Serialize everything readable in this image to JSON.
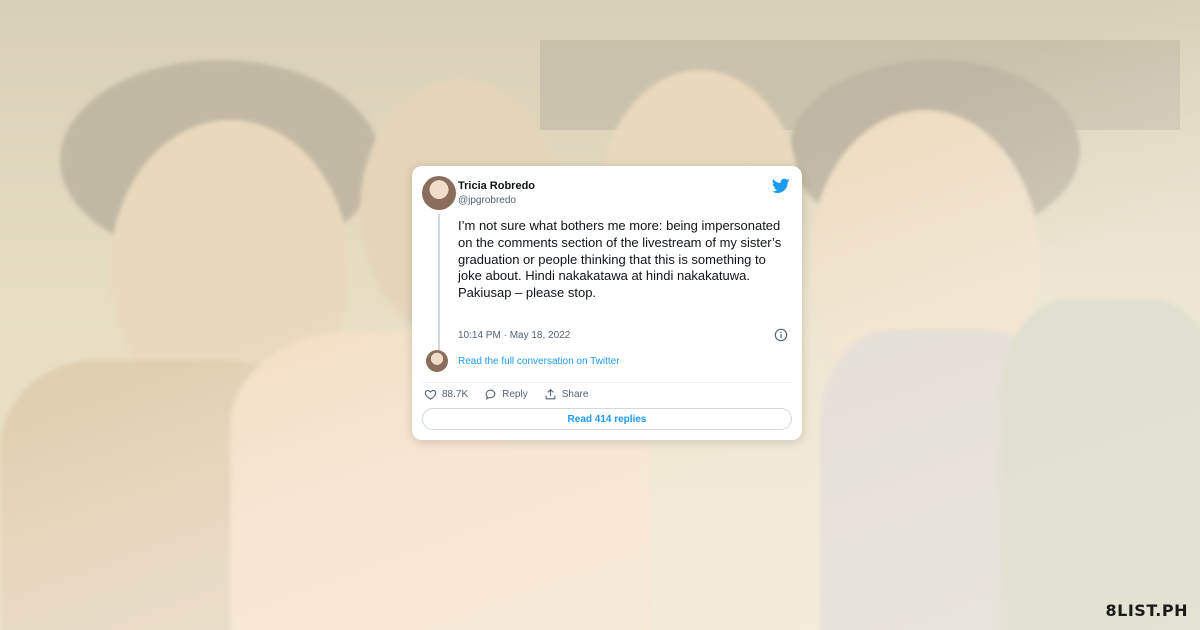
{
  "tweet": {
    "author_name": "Tricia Robredo",
    "author_handle": "@jpgrobredo",
    "text": "I’m not sure what bothers me more: being impersonated on the comments section of the livestream of my sister’s graduation or people thinking that this is something to joke about. Hindi nakakatawa at hindi nakakatuwa. Pakiusap – please stop.",
    "timestamp": "10:14 PM · May 18, 2022",
    "full_conversation_link": "Read the full conversation on Twitter",
    "likes_count": "88.7K",
    "reply_label": "Reply",
    "share_label": "Share",
    "read_replies_label": "Read 414 replies"
  },
  "brand": {
    "logo_text": "8LIST.PH"
  },
  "colors": {
    "twitter_blue": "#1d9bf0",
    "text_primary": "#0f1419",
    "text_secondary": "#536471"
  },
  "icons": {
    "twitter": "twitter-bird-icon",
    "info": "info-icon",
    "like": "heart-icon",
    "reply": "speech-bubble-icon",
    "share": "share-icon"
  }
}
